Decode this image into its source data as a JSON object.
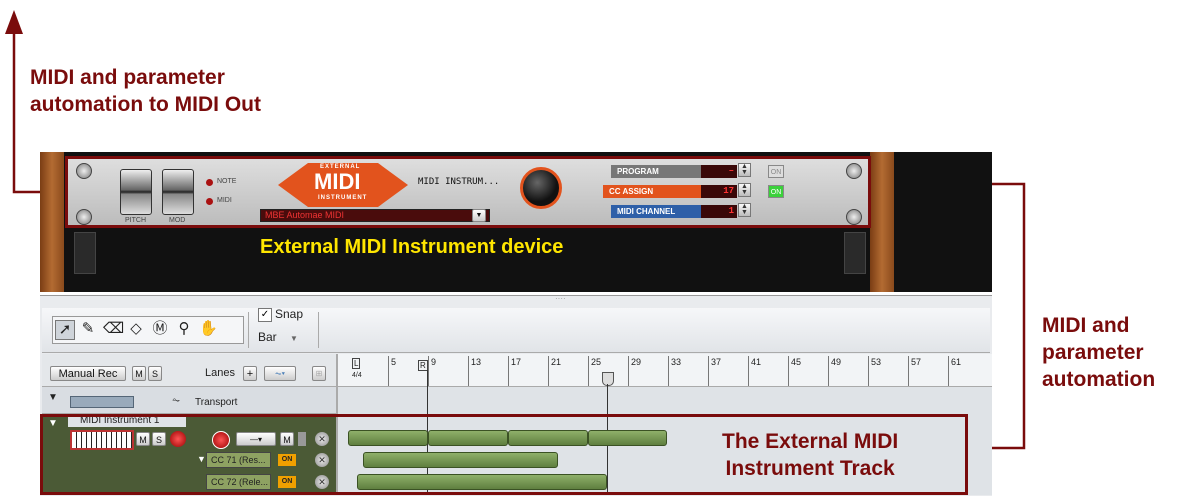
{
  "callouts": {
    "midi_out": [
      "MIDI and parameter",
      "automation to MIDI Out"
    ],
    "device": "External MIDI Instrument device",
    "param": [
      "MIDI and",
      "parameter",
      "automation"
    ],
    "track": [
      "The External MIDI",
      "Instrument Track"
    ]
  },
  "device": {
    "logo_top": "EXTERNAL",
    "logo_main": "MIDI",
    "logo_bottom": "INSTRUMENT",
    "name": "MIDI INSTRUM...",
    "pitch_label": "PITCH",
    "mod_label": "MOD",
    "note_label": "NOTE",
    "midi_label": "MIDI",
    "output_select": "MBE Automae MIDI",
    "program_label": "PROGRAM",
    "program_value": "–",
    "cc_assign_label": "CC ASSIGN",
    "cc_assign_value": "17",
    "midi_channel_label": "MIDI CHANNEL",
    "midi_channel_value": "1",
    "on_label": "ON",
    "colors": {
      "brand": "#e2531d",
      "frame": "#7a0c0c",
      "on_green": "#3bd13b"
    }
  },
  "toolbar": {
    "tools": [
      "select-tool",
      "pencil-tool",
      "eraser-tool",
      "razor-tool",
      "mute-tool",
      "magnify-tool",
      "hand-tool"
    ],
    "snap_label": "Snap",
    "snap_checked": true,
    "snap_value": "Bar"
  },
  "track_list": {
    "manual_rec": "Manual Rec",
    "m": "M",
    "s": "S",
    "lanes": "Lanes",
    "add": "+",
    "transport_label": "Transport",
    "instrument_track_name": "MIDI Instrument 1",
    "cc_lanes": [
      "CC 71 (Res...",
      "CC 72 (Rele..."
    ],
    "on": "ON"
  },
  "ruler": {
    "ticks": [
      "5",
      "9",
      "13",
      "17",
      "21",
      "25",
      "29",
      "33",
      "37",
      "41",
      "45",
      "49",
      "53",
      "57",
      "61"
    ],
    "l_marker": "L",
    "r_marker": "R",
    "time_sig": "4/4"
  }
}
